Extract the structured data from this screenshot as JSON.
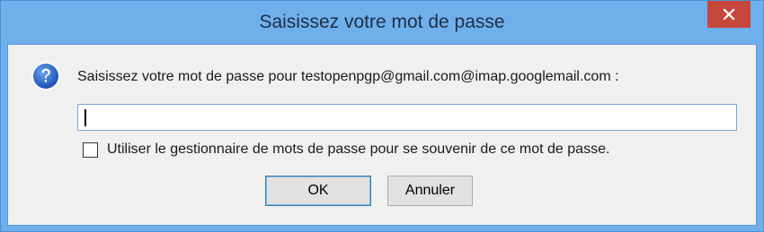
{
  "window": {
    "title": "Saisissez votre mot de passe"
  },
  "dialog": {
    "icon": "question-icon",
    "prompt": "Saisissez votre mot de passe pour testopenpgp@gmail.com@imap.googlemail.com :",
    "password_value": "",
    "remember_checked": false,
    "remember_label": "Utiliser le gestionnaire de mots de passe pour se souvenir de ce mot de passe.",
    "ok_label": "OK",
    "cancel_label": "Annuler"
  },
  "colors": {
    "frame": "#6fb0ec",
    "close_button": "#c7463b",
    "client_bg": "#f0f0f0"
  }
}
